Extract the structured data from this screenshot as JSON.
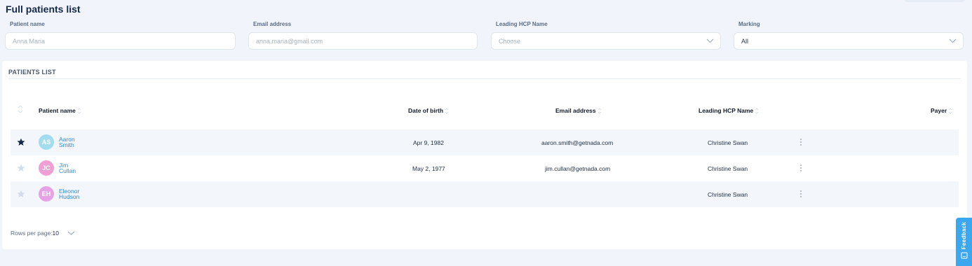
{
  "page": {
    "title": "Full patients list"
  },
  "filters": {
    "patient_name": {
      "label": "Patient name",
      "placeholder": "Anna Maria"
    },
    "email": {
      "label": "Email address",
      "placeholder": "anna.maria@gmail.com"
    },
    "hcp": {
      "label": "Leading HCP Name",
      "placeholder": "Choose"
    },
    "marking": {
      "label": "Marking",
      "value": "All"
    }
  },
  "patients_list": {
    "title": "PATIENTS LIST",
    "columns": {
      "name": "Patient name",
      "dob": "Date of birth",
      "email": "Email address",
      "hcp": "Leading HCP Name",
      "payer": "Payer"
    },
    "rows": [
      {
        "initials": "AS",
        "first": "Aaron",
        "last": "Smith",
        "dob": "Apr 9, 1982",
        "email": "aaron.smith@getnada.com",
        "hcp": "Christine Swan",
        "starred": true,
        "avatar_color": "#a4dcef"
      },
      {
        "initials": "JC",
        "first": "Jim",
        "last": "Cullan",
        "dob": "May 2, 1977",
        "email": "jim.cullan@getnada.com",
        "hcp": "Christine Swan",
        "starred": false,
        "avatar_color": "#ef9fd3"
      },
      {
        "initials": "EH",
        "first": "Eleonor",
        "last": "Hudson",
        "dob": "",
        "email": "",
        "hcp": "Christine Swan",
        "starred": false,
        "avatar_color": "#e5a3e6"
      }
    ]
  },
  "pagination": {
    "label": "Rows per page:",
    "value": "10"
  },
  "feedback": {
    "label": "Feedback"
  },
  "colors": {
    "accent": "#3aa7ee",
    "link": "#2f86d6",
    "star_active": "#13284a",
    "star_inactive": "#d3dde9"
  }
}
